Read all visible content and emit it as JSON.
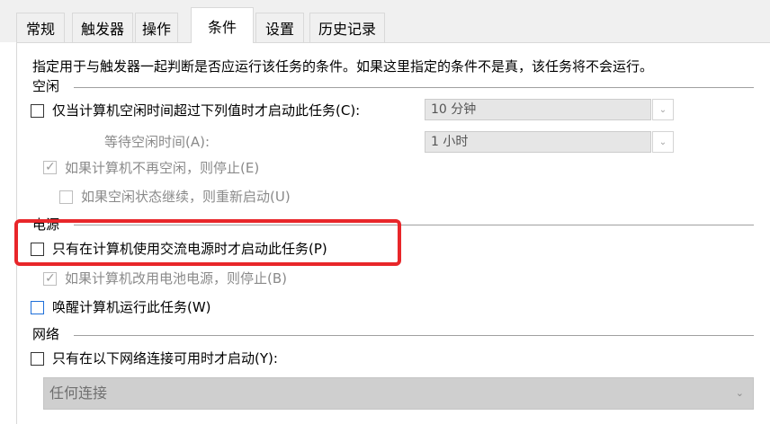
{
  "tabs": [
    {
      "label": "常规"
    },
    {
      "label": "触发器"
    },
    {
      "label": "操作"
    },
    {
      "label": "条件"
    },
    {
      "label": "设置"
    },
    {
      "label": "历史记录"
    }
  ],
  "description": "指定用于与触发器一起判断是否应运行该任务的条件。如果这里指定的条件不是真，该任务将不会运行。",
  "idle": {
    "title": "空闲",
    "start_only_if_idle": {
      "label": "仅当计算机空闲时间超过下列值时才启动此任务(C):",
      "checked": false
    },
    "idle_duration": {
      "value": "10 分钟"
    },
    "wait_label": "等待空闲时间(A):",
    "wait_duration": {
      "value": "1 小时"
    },
    "stop_if_not_idle": {
      "label": "如果计算机不再空闲，则停止(E)",
      "checked": true
    },
    "restart_if_idle": {
      "label": "如果空闲状态继续，则重新启动(U)",
      "checked": false
    }
  },
  "power": {
    "title": "电源",
    "ac_only": {
      "label": "只有在计算机使用交流电源时才启动此任务(P)",
      "checked": false
    },
    "stop_on_battery": {
      "label": "如果计算机改用电池电源，则停止(B)",
      "checked": true
    },
    "wake_to_run": {
      "label": "唤醒计算机运行此任务(W)",
      "checked": false
    }
  },
  "network": {
    "title": "网络",
    "start_only_if_network": {
      "label": "只有在以下网络连接可用时才启动(Y):",
      "checked": false
    },
    "connection": {
      "value": "任何连接"
    }
  },
  "icons": {
    "dropdown": "chevron-down-icon",
    "check": "check-icon"
  },
  "colors": {
    "highlight": "#e8262a",
    "focus": "#1e6fd9"
  }
}
